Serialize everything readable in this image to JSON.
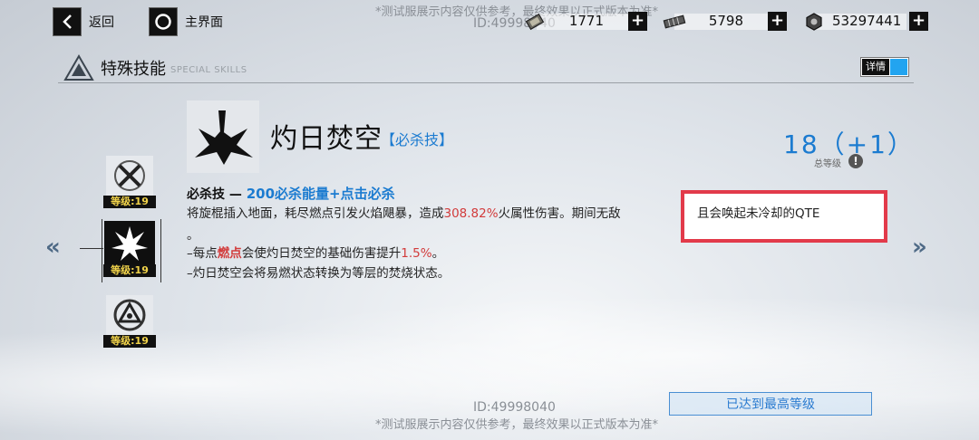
{
  "topbar": {
    "back_label": "返回",
    "home_label": "主界面",
    "watermark_top": "*测试服展示内容仅供参考，最终效果以正式版本为准*",
    "id_top": "ID:49998040",
    "resources": [
      {
        "icon": "ticket-icon",
        "value": "1771"
      },
      {
        "icon": "ammo-icon",
        "value": "5798"
      },
      {
        "icon": "hex-nut-icon",
        "value": "53297441"
      }
    ]
  },
  "section": {
    "title": "特殊技能",
    "subtitle": "SPECIAL SKILLS",
    "details_label": "详情"
  },
  "skills_list": [
    {
      "icon": "crossed-blades-icon",
      "level": "等级:19"
    },
    {
      "icon": "burst-icon",
      "level": "等级:19",
      "tag": "Level",
      "selected": true
    },
    {
      "icon": "triangle-ring-icon",
      "level": "等级:19"
    }
  ],
  "skill": {
    "name": "灼日焚空",
    "type": "【必杀技】",
    "level_value": "18（+1）",
    "level_label": "总等级",
    "line1_prefix": "必杀技 — ",
    "line1_accent": "200必杀能量+点击必杀",
    "desc1_a": "将旋棍插入地面，耗尽燃点引发火焰飓暴，造成",
    "desc1_pct": "308.82%",
    "desc1_b": "火属性伤害。期间无敌",
    "desc1_hidden": "，",
    "highlight_text": "且会唤起未冷却的QTE",
    "desc1_end": "。",
    "desc2_a": "–每点",
    "desc2_kw": "燃点",
    "desc2_b": "会使灼日焚空的基础伤害提升",
    "desc2_pct": "1.5%",
    "desc2_c": "。",
    "desc3": "–灼日焚空会将易燃状态转换为等层的焚烧状态。"
  },
  "footer": {
    "id_bottom": "ID:49998040",
    "watermark_bottom": "*测试服展示内容仅供参考，最终效果以正式版本为准*",
    "max_button": "已达到最高等级"
  },
  "colors": {
    "accent_blue": "#1b7bd0",
    "highlight_red": "#e23a4a",
    "level_yellow": "#f1d34a",
    "toggle_blue": "#22a4f0"
  }
}
